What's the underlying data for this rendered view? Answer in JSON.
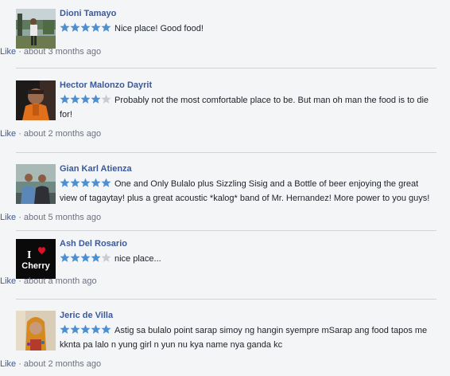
{
  "reviews": [
    {
      "name": "Dioni Tamayo",
      "rating": 5,
      "text": "Nice place! Good food!",
      "like_label": "Like",
      "separator": "·",
      "time": "about 3 months ago",
      "avatar_icon": "person-photo"
    },
    {
      "name": "Hector Malonzo Dayrit",
      "rating": 4,
      "text": "Probably not the most comfortable place to be. But man oh man the food is to die for!",
      "like_label": "Like",
      "separator": "·",
      "time": "about 2 months ago",
      "avatar_icon": "person-photo"
    },
    {
      "name": "Gian Karl Atienza",
      "rating": 5,
      "text": "One and Only Bulalo plus Sizzling Sisig and a Bottle of beer enjoying the great view of tagaytay! plus a great acoustic *kalog* band of Mr. Hernandez! More power to you guys!",
      "like_label": "Like",
      "separator": "·",
      "time": "about 5 months ago",
      "avatar_icon": "group-photo"
    },
    {
      "name": "Ash Del Rosario",
      "rating": 4,
      "text": "nice place...",
      "like_label": "Like",
      "separator": "·",
      "time": "about a month ago",
      "avatar_icon": "i-love-cherry-logo",
      "avatar_text": [
        "I",
        "Cherry"
      ]
    },
    {
      "name": "Jeric de Villa",
      "rating": 5,
      "text": "Astig sa bulalo point sarap simoy ng hangin syempre mSarap ang food tapos me kknta pa lalo n yung girl n yun nu kya name nya ganda kc",
      "like_label": "Like",
      "separator": "·",
      "time": "about 2 months ago",
      "avatar_icon": "person-photo"
    }
  ],
  "colors": {
    "name_link": "#3b5998",
    "star_filled": "#4e8fd0",
    "star_empty": "#c8ccd2",
    "meta_text": "#6a7180",
    "divider": "#d0d3d8",
    "background": "#f4f5f7"
  }
}
